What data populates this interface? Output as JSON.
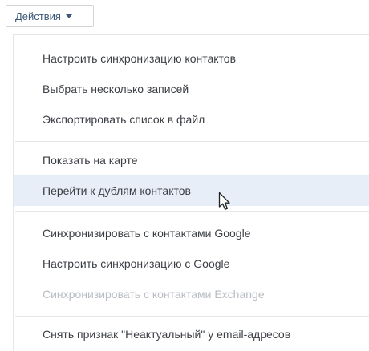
{
  "actions_button": {
    "label": "Действия"
  },
  "menu": {
    "items": [
      {
        "label": "Настроить синхронизацию контактов",
        "state": "enabled"
      },
      {
        "label": "Выбрать несколько записей",
        "state": "enabled"
      },
      {
        "label": "Экспортировать список в файл",
        "state": "enabled"
      },
      {
        "label": "Показать на карте",
        "state": "enabled"
      },
      {
        "label": "Перейти к дублям контактов",
        "state": "highlighted"
      },
      {
        "label": "Синхронизировать с контактами Google",
        "state": "enabled"
      },
      {
        "label": "Настроить синхронизацию с Google",
        "state": "enabled"
      },
      {
        "label": "Синхронизировать с контактами Exchange",
        "state": "disabled"
      },
      {
        "label": "Снять признак \"Неактуальный\" у email-адресов",
        "state": "enabled"
      }
    ]
  },
  "icons": {
    "dropdown": "caret-down-icon",
    "pointer": "mouse-pointer-icon"
  },
  "colors": {
    "button_text": "#3e5a7a",
    "item_text": "#3b3f44",
    "disabled_text": "#b8bdc3",
    "highlight_bg": "#e7eef8",
    "border": "#e3e6ea"
  }
}
